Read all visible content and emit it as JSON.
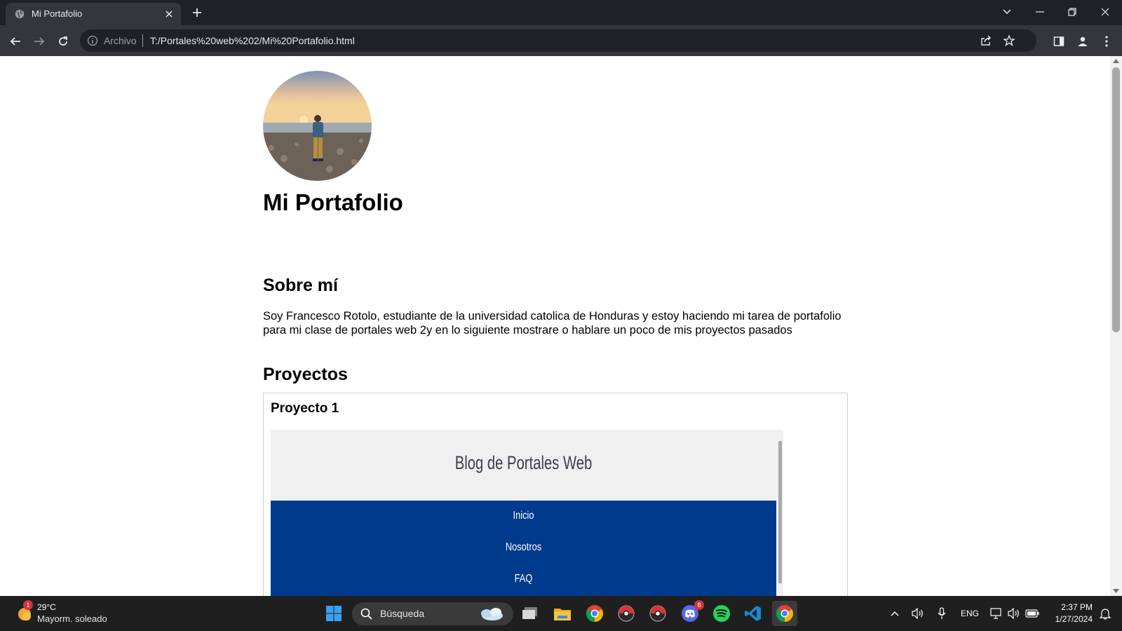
{
  "browser": {
    "tab_title": "Mi Portafolio",
    "address_scheme": "Archivo",
    "address_url": "T:/Portales%20web%202/Mi%20Portafolio.html"
  },
  "page": {
    "title": "Mi Portafolio",
    "about_heading": "Sobre mí",
    "about_text": "Soy Francesco Rotolo, estudiante de la universidad catolica de Honduras y estoy haciendo mi tarea de portafolio para mi clase de portales web 2y en lo siguiente mostrare o hablare un poco de mis proyectos pasados",
    "projects_heading": "Proyectos",
    "projects": [
      {
        "title": "Proyecto 1",
        "preview": {
          "blog_title": "Blog de Portales Web",
          "nav": [
            "Inicio",
            "Nosotros",
            "FAQ"
          ]
        }
      }
    ]
  },
  "taskbar": {
    "weather_temp": "29°C",
    "weather_desc": "Mayorm. soleado",
    "weather_badge": "1",
    "search_label": "Búsqueda",
    "discord_badge": "8",
    "language": "ENG",
    "time": "2:37 PM",
    "date": "1/27/2024"
  },
  "colors": {
    "preview_nav": "#003a8c",
    "browser_frame": "#202124",
    "taskbar": "#1f1f1f"
  }
}
